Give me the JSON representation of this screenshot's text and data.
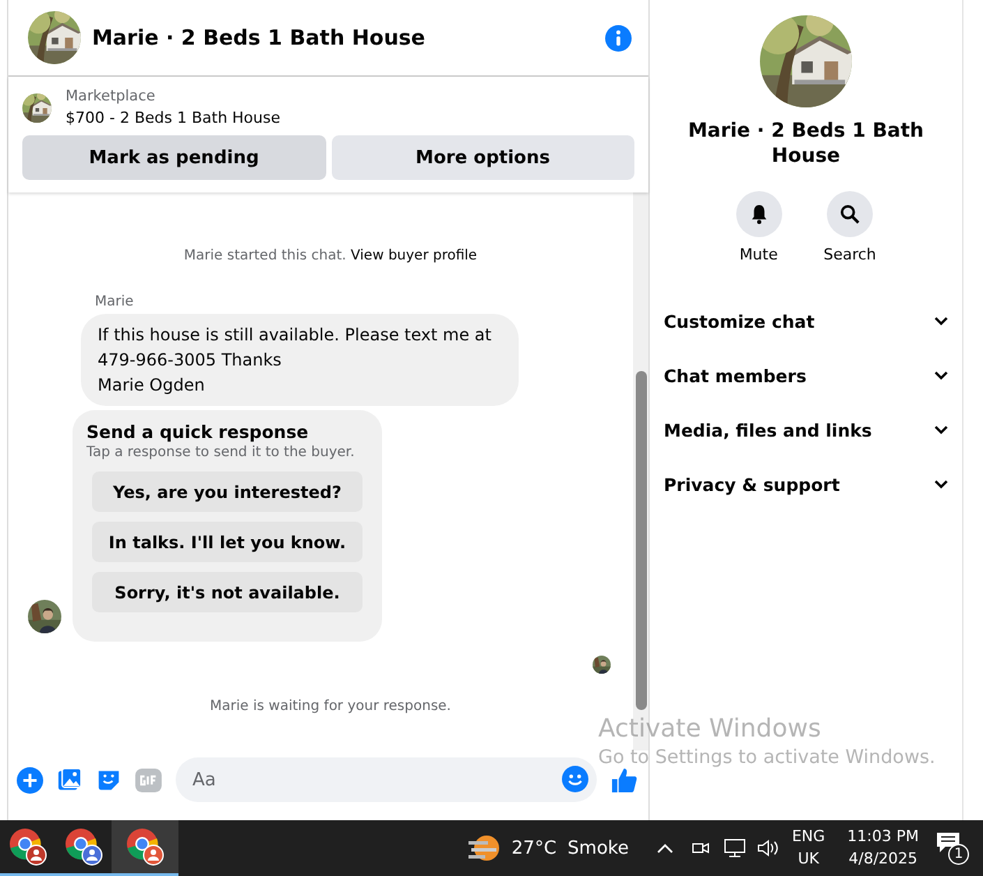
{
  "header": {
    "title": "Marie · 2 Beds 1 Bath House"
  },
  "listing": {
    "source": "Marketplace",
    "title": "$700 - 2 Beds 1 Bath House"
  },
  "actions": [
    {
      "label": "Mark as pending",
      "selected": true
    },
    {
      "label": "More options",
      "selected": false
    }
  ],
  "chat": {
    "start_note": {
      "text": "Marie started this chat.",
      "link": "View buyer profile"
    },
    "sender": "Marie",
    "message": [
      "If this house is still available.  Please text me at",
      "479-966-3005  Thanks",
      "Marie Ogden"
    ],
    "quick_response": {
      "title": "Send a quick response",
      "hint": "Tap a response to send it to the buyer.",
      "options": [
        "Yes, are you interested?",
        "In talks. I'll let you know.",
        "Sorry, it's not available."
      ]
    },
    "waiting_note": "Marie is waiting for your response."
  },
  "composer": {
    "placeholder": "Aa"
  },
  "details": {
    "title": "Marie · 2 Beds 1 Bath House",
    "buttons": [
      {
        "kind": "mute",
        "label": "Mute"
      },
      {
        "kind": "search",
        "label": "Search"
      }
    ],
    "sections": [
      {
        "label": "Customize chat",
        "expanded": false
      },
      {
        "label": "Chat members",
        "expanded": false
      },
      {
        "label": "Media, files and links",
        "expanded": false
      },
      {
        "label": "Privacy & support",
        "expanded": false
      }
    ]
  },
  "activation": {
    "title": "Activate Windows",
    "subtitle": "Go to Settings to activate Windows."
  },
  "taskbar": {
    "temperature": "27°C",
    "condition": "Smoke",
    "language": "ENG",
    "region": "UK",
    "time": "11:03 PM",
    "date": "4/8/2025",
    "notifications": "1"
  }
}
